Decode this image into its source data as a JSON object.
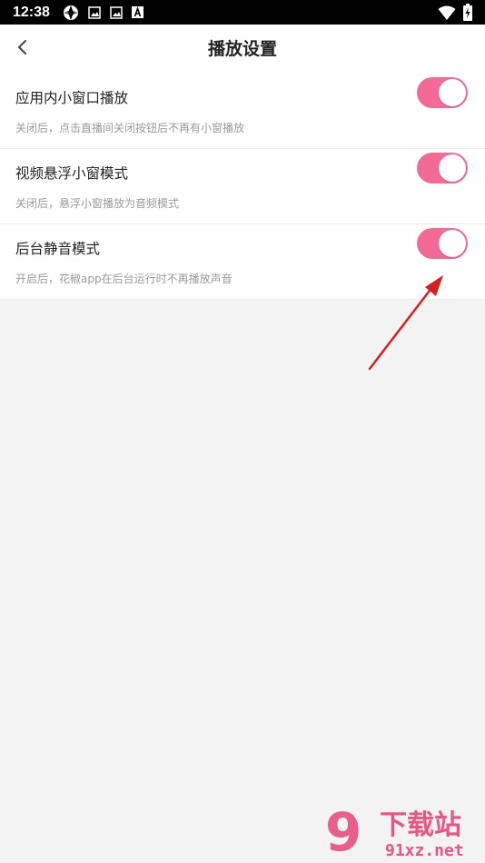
{
  "status_bar": {
    "time": "12:38",
    "icons_left": [
      "app-logo-icon",
      "gallery-icon",
      "gallery-icon",
      "text-a-icon"
    ],
    "icons_right": [
      "wifi-icon",
      "battery-charging-icon"
    ]
  },
  "header": {
    "back_icon": "chevron-left-icon",
    "title": "播放设置"
  },
  "settings": {
    "items": [
      {
        "label": "应用内小窗口播放",
        "description": "关闭后，点击直播间关闭按钮后不再有小窗播放",
        "enabled": true
      },
      {
        "label": "视频悬浮小窗模式",
        "description": "关闭后，悬浮小窗播放为音频模式",
        "enabled": true
      },
      {
        "label": "后台静音模式",
        "description": "开启后，花椒app在后台运行时不再播放声音",
        "enabled": true
      }
    ]
  },
  "colors": {
    "toggle_on": "#f46a97",
    "annotation_arrow": "#e02020",
    "watermark": "#e8457a"
  },
  "watermark": {
    "brand_number": "9",
    "brand_text": "下载站",
    "site": "91xz.net"
  }
}
